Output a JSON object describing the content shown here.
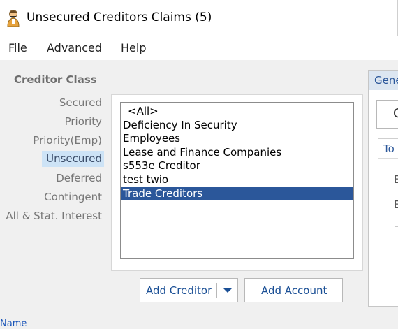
{
  "window": {
    "title": "Unsecured Creditors Claims (5)",
    "app_icon": "person-icon"
  },
  "menu": {
    "items": [
      {
        "id": "file",
        "label": "File"
      },
      {
        "id": "advanced",
        "label": "Advanced"
      },
      {
        "id": "help",
        "label": "Help"
      }
    ]
  },
  "creditor_class": {
    "title": "Creditor Class",
    "selected": "Unsecured",
    "items": [
      {
        "label": "Secured"
      },
      {
        "label": "Priority"
      },
      {
        "label": "Priority(Emp)"
      },
      {
        "label": "Unsecured"
      },
      {
        "label": "Deferred"
      },
      {
        "label": "Contingent"
      },
      {
        "label": "All & Stat. Interest"
      }
    ]
  },
  "creditor_list": {
    "selected": "Trade Creditors",
    "items": [
      {
        "label": "<All>"
      },
      {
        "label": "Deficiency In Security"
      },
      {
        "label": "Employees"
      },
      {
        "label": "Lease and Finance Companies"
      },
      {
        "label": "s553e Creditor"
      },
      {
        "label": "test twio"
      },
      {
        "label": "Trade Creditors"
      }
    ]
  },
  "buttons": {
    "add_creditor": "Add Creditor",
    "add_account": "Add Account"
  },
  "right_panel": {
    "tab_label": "Gene",
    "box_text": "C",
    "group_title": "To",
    "letters": [
      "E",
      "E"
    ]
  },
  "footer": {
    "name_label": "Name"
  },
  "colors": {
    "selection": "#2b579a",
    "class_selection": "#cde3f6",
    "link_blue": "#1a4f95"
  }
}
